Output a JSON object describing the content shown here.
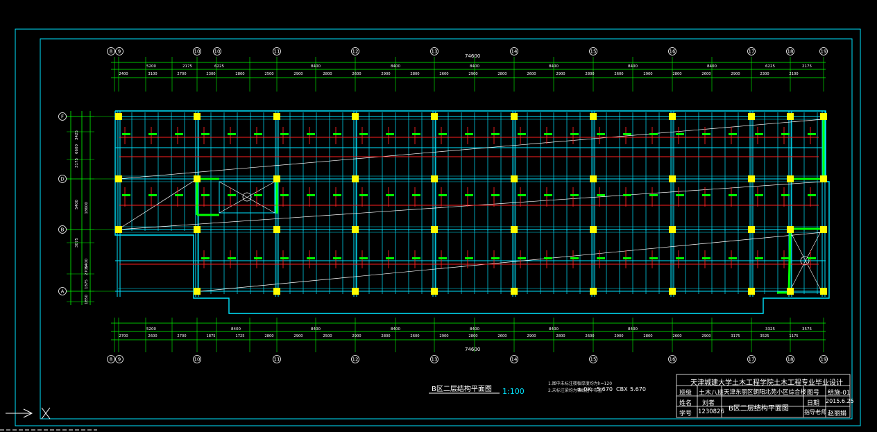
{
  "drawing": {
    "title_block": {
      "school": "天津城建大学土木工程学院土木工程专业毕业设计",
      "class_label": "班级",
      "class_value": "土木八班",
      "project_value": "天津东丽区朝阳北苑小区综合楼",
      "drawing_no_label": "图号",
      "drawing_no_value": "结施-01",
      "name_label": "姓名",
      "name_value": "刘者",
      "student_no_label": "学号",
      "student_no_value": "1230826",
      "drawing_title": "B区二层结构平面图",
      "date_label": "日期",
      "date_value": "2015.6.25",
      "advisor_label": "指导老师",
      "advisor_value": "赵丽娟"
    },
    "plan_title": "B区二层结构平面图",
    "plan_scale": "1:100",
    "note_line1": "1.图中未标注楼板厚度均为h=120",
    "note_line2": "2.未标注梁均为轴线居中布置",
    "note_mark": "± 0X",
    "note_elev1": "5.670",
    "note_elev_label": "CBX",
    "note_elev2": "5.670",
    "top_total": "74600",
    "bottom_total": "74600",
    "top_axes": [
      "8",
      "9",
      "10",
      "10",
      "11",
      "12",
      "13",
      "14",
      "15",
      "16",
      "17",
      "18",
      "19"
    ],
    "bottom_axes": [
      "8",
      "9",
      "10",
      "11",
      "12",
      "13",
      "14",
      "15",
      "16",
      "17",
      "18",
      "19"
    ],
    "left_axes": [
      "F",
      "D",
      "B",
      "A"
    ],
    "top_dims_row1": [
      "5200",
      "2175",
      "6225",
      "8400",
      "8400",
      "8400",
      "8400",
      "8400",
      "8400",
      "6225",
      "2175"
    ],
    "top_dims_row2": [
      "2400",
      "3100",
      "2700",
      "2300",
      "2800",
      "2500",
      "2900",
      "2800",
      "2600",
      "2900",
      "2800",
      "2600",
      "2900",
      "2800",
      "2600",
      "2900",
      "2800",
      "2600",
      "2900",
      "2800",
      "2600",
      "2900",
      "2300",
      "2100"
    ],
    "bottom_dims_row1": [
      "5200",
      "8400",
      "8400",
      "8400",
      "8400",
      "8400",
      "8400",
      "3325",
      "3575"
    ],
    "bottom_dims_row2": [
      "2700",
      "2600",
      "2700",
      "1875",
      "1725",
      "2800",
      "2900",
      "2500",
      "2900",
      "2800",
      "2600",
      "2900",
      "2800",
      "2600",
      "2900",
      "2800",
      "2600",
      "2900",
      "2800",
      "2600",
      "2900",
      "3175",
      "3525",
      "1175"
    ],
    "left_dims": [
      "3425",
      "3175",
      "6600",
      "5400",
      "3075",
      "2700",
      "1875",
      "1850",
      "5400",
      "18600"
    ],
    "colors": {
      "background": "#000000",
      "border": "#00e5ff",
      "beam": "#00e5ff",
      "wall": "#00ff00",
      "column": "#ffff00",
      "dimension": "#00ff00",
      "rebar": "#ff2020",
      "text": "#ffffff"
    }
  }
}
